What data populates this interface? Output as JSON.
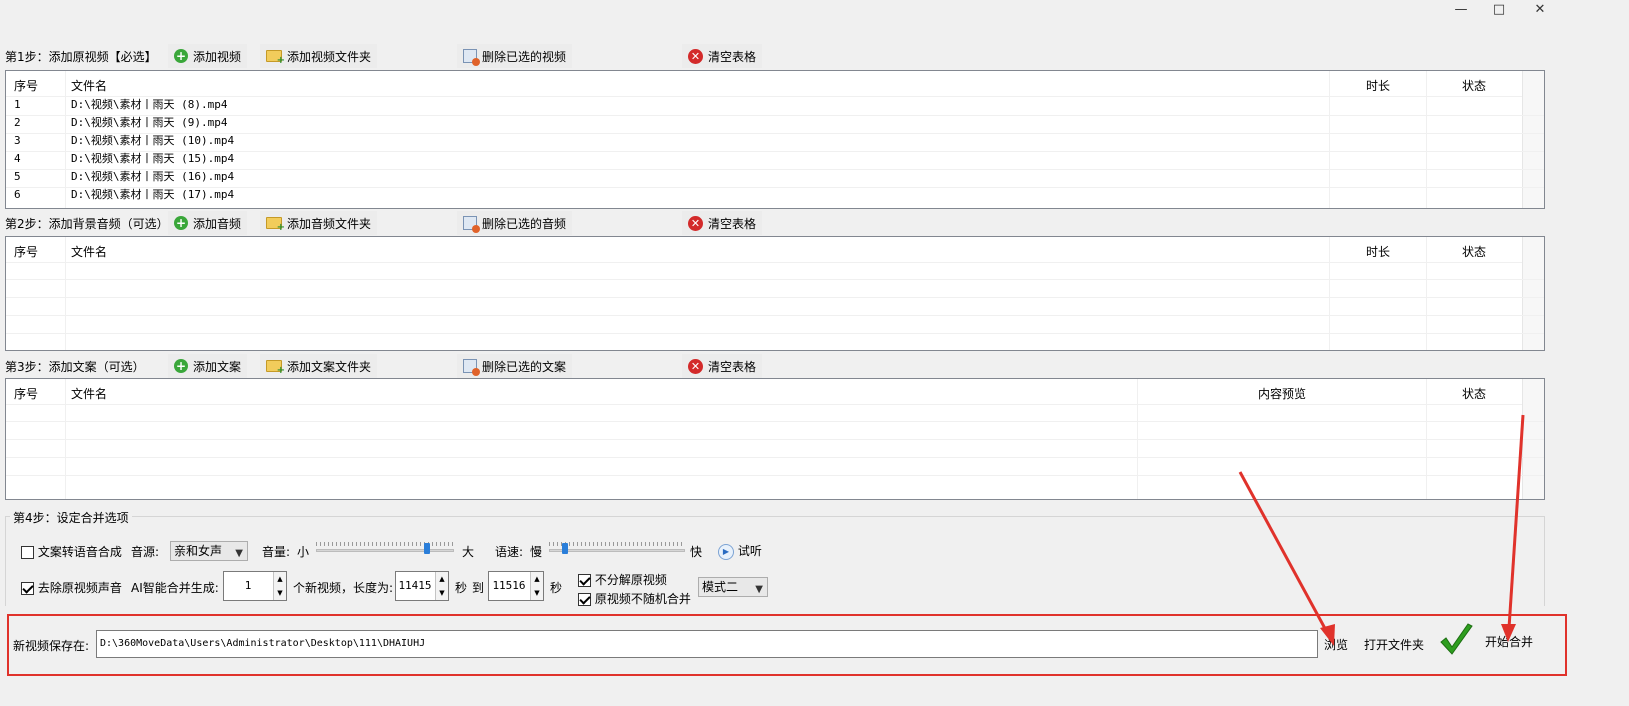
{
  "window": {
    "minimize": "—",
    "maximize": "□",
    "close": "✕"
  },
  "step1": {
    "title": "第1步：添加原视频【必选】",
    "add": "添加视频",
    "add_folder": "添加视频文件夹",
    "delete": "删除已选的视频",
    "clear": "清空表格",
    "columns": [
      "序号",
      "文件名",
      "时长",
      "状态"
    ],
    "rows": [
      {
        "no": "1",
        "file": "D:\\视频\\素材丨雨天 (8).mp4"
      },
      {
        "no": "2",
        "file": "D:\\视频\\素材丨雨天 (9).mp4"
      },
      {
        "no": "3",
        "file": "D:\\视频\\素材丨雨天 (10).mp4"
      },
      {
        "no": "4",
        "file": "D:\\视频\\素材丨雨天 (15).mp4"
      },
      {
        "no": "5",
        "file": "D:\\视频\\素材丨雨天 (16).mp4"
      },
      {
        "no": "6",
        "file": "D:\\视频\\素材丨雨天 (17).mp4"
      }
    ]
  },
  "step2": {
    "title": "第2步：添加背景音频（可选）",
    "add": "添加音频",
    "add_folder": "添加音频文件夹",
    "delete": "删除已选的音频",
    "clear": "清空表格",
    "columns": [
      "序号",
      "文件名",
      "时长",
      "状态"
    ]
  },
  "step3": {
    "title": "第3步：添加文案（可选）",
    "add": "添加文案",
    "add_folder": "添加文案文件夹",
    "delete": "删除已选的文案",
    "clear": "清空表格",
    "columns": [
      "序号",
      "文件名",
      "内容预览",
      "状态"
    ]
  },
  "step4": {
    "title": "第4步：设定合并选项",
    "tts_label": "文案转语音合成",
    "tts_checked": false,
    "voice_label": "音源:",
    "voice_value": "亲和女声",
    "volume_label": "音量:",
    "volume_min": "小",
    "volume_max": "大",
    "volume_level": 0.82,
    "speed_label": "语速:",
    "speed_min": "慢",
    "speed_max": "快",
    "speed_level": 0.1,
    "preview": "试听",
    "remove_audio_label": "去除原视频声音",
    "remove_audio_checked": true,
    "ai_label": "AI智能合并生成:",
    "count_value": "1",
    "count_suffix": "个新视频，长度为:",
    "len_from": "11415",
    "sec1": "秒",
    "to": "到",
    "len_to": "11516",
    "sec2": "秒",
    "no_split_label": "不分解原视频",
    "no_split_checked": true,
    "no_random_label": "原视频不随机合并",
    "no_random_checked": true,
    "mode_value": "模式二"
  },
  "save": {
    "label": "新视频保存在:",
    "path": "D:\\360MoveData\\Users\\Administrator\\Desktop\\111\\DHAIUHJ",
    "browse": "浏览",
    "open_folder": "打开文件夹",
    "start": "开始合并"
  },
  "colors": {
    "highlight": "#e0322b",
    "check_green": "#2e9e1f"
  }
}
